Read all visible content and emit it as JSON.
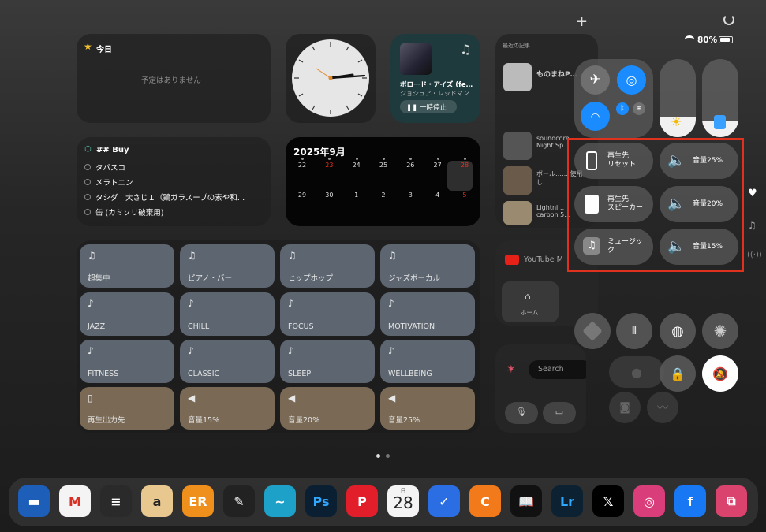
{
  "today_widget": {
    "title": "今日",
    "empty": "予定はありません"
  },
  "music_widget": {
    "title": "ボロード・アイズ (fe…",
    "artist": "ジョシュア・レッドマン",
    "pause_label": "一時停止"
  },
  "reminders": {
    "title": "## Buy",
    "items": [
      "タバスコ",
      "メラトニン",
      "タシダ　大さじ１（鶏ガラスープの素や和…",
      "缶 (カミソリ破棄用)"
    ]
  },
  "calendar": {
    "title": "2025年9月",
    "row1": [
      "22",
      "23",
      "24",
      "25",
      "26",
      "27",
      "28"
    ],
    "row2": [
      "29",
      "30",
      "1",
      "2",
      "3",
      "4",
      "5"
    ]
  },
  "news_widget": {
    "header": "最近の記事",
    "items": [
      "ものまねP…",
      "soundcore… Night Sp…",
      "ボール…… 使用し…",
      "Lightni… carbon 5…"
    ]
  },
  "youtube": {
    "label": "YouTube M",
    "home": "ホーム"
  },
  "search_widget": {
    "placeholder": "Search"
  },
  "shortcuts": [
    {
      "label": "超集中",
      "icon": "music-note-list-icon"
    },
    {
      "label": "ピアノ・バー",
      "icon": "music-note-list-icon"
    },
    {
      "label": "ヒップホップ",
      "icon": "music-note-list-icon"
    },
    {
      "label": "ジャズボーカル",
      "icon": "music-note-list-icon"
    },
    {
      "label": "JAZZ",
      "icon": "music-lock-icon"
    },
    {
      "label": "CHILL",
      "icon": "music-lock-icon"
    },
    {
      "label": "FOCUS",
      "icon": "music-lock-icon"
    },
    {
      "label": "MOTIVATION",
      "icon": "music-lock-icon"
    },
    {
      "label": "FITNESS",
      "icon": "music-lock-icon"
    },
    {
      "label": "CLASSIC",
      "icon": "music-lock-icon"
    },
    {
      "label": "SLEEP",
      "icon": "music-lock-icon"
    },
    {
      "label": "WELLBEING",
      "icon": "music-lock-icon"
    },
    {
      "label": "再生出力先",
      "icon": "speaker-icon"
    },
    {
      "label": "音量15%",
      "icon": "volume-icon"
    },
    {
      "label": "音量20%",
      "icon": "volume-icon"
    },
    {
      "label": "音量25%",
      "icon": "volume-icon"
    }
  ],
  "status": {
    "battery": "80%"
  },
  "control_center": {
    "buttons": [
      {
        "label": "再生先\nリセット",
        "icon": "iphone-icon"
      },
      {
        "label": "再生先\nスピーカー",
        "icon": "speaker-icon"
      },
      {
        "label": "ミュージッ\nク",
        "icon": "music-app-icon"
      }
    ],
    "volumes": [
      "音量25%",
      "音量20%",
      "音量15%"
    ],
    "brightness_level": 0.25,
    "volume_level": 0.15
  },
  "dock": {
    "calendar_day": "日",
    "calendar_date": "28",
    "apps": [
      "files-icon",
      "gmail-icon",
      "notes-icon",
      "amazon-icon",
      "books-icon",
      "writing-icon",
      "freeform-icon",
      "photoshop-icon",
      "pinterest-icon",
      "calendar-icon",
      "things-icon",
      "castro-icon",
      "kindle-icon",
      "lightroom-icon",
      "x-icon",
      "instagram-icon",
      "facebook-icon",
      "shortcuts-app-icon"
    ]
  },
  "highlight_color": "#e0301e"
}
